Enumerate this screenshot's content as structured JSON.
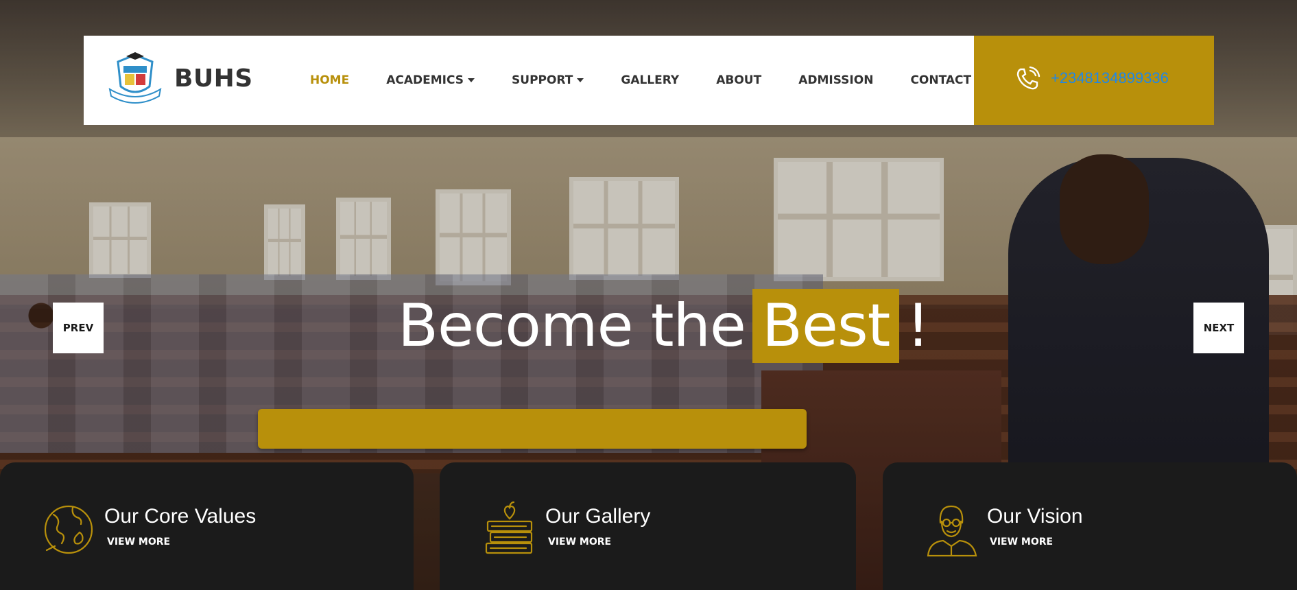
{
  "brand": {
    "name": "BUHS"
  },
  "nav": {
    "items": [
      {
        "label": "HOME",
        "active": true,
        "dropdown": false
      },
      {
        "label": "ACADEMICS",
        "active": false,
        "dropdown": true
      },
      {
        "label": "SUPPORT",
        "active": false,
        "dropdown": true
      },
      {
        "label": "GALLERY",
        "active": false,
        "dropdown": false
      },
      {
        "label": "ABOUT",
        "active": false,
        "dropdown": false
      },
      {
        "label": "ADMISSION",
        "active": false,
        "dropdown": false
      },
      {
        "label": "CONTACT",
        "active": false,
        "dropdown": false
      }
    ]
  },
  "contact": {
    "phone": "+2348134899336",
    "icon": "phone-icon"
  },
  "hero": {
    "headline_pre": "Become the",
    "headline_highlight": "Best",
    "headline_post": "!",
    "prev_label": "PREV",
    "next_label": "NEXT"
  },
  "cards": [
    {
      "title": "Our Core Values",
      "link": "VIEW MORE",
      "icon": "globe-icon"
    },
    {
      "title": "Our Gallery",
      "link": "VIEW MORE",
      "icon": "books-apple-icon"
    },
    {
      "title": "Our Vision",
      "link": "VIEW MORE",
      "icon": "teacher-icon"
    }
  ],
  "colors": {
    "accent": "#b8900b",
    "phone_text": "#1f87e8",
    "card_bg": "#1b1b1b",
    "nav_text": "#333333"
  }
}
